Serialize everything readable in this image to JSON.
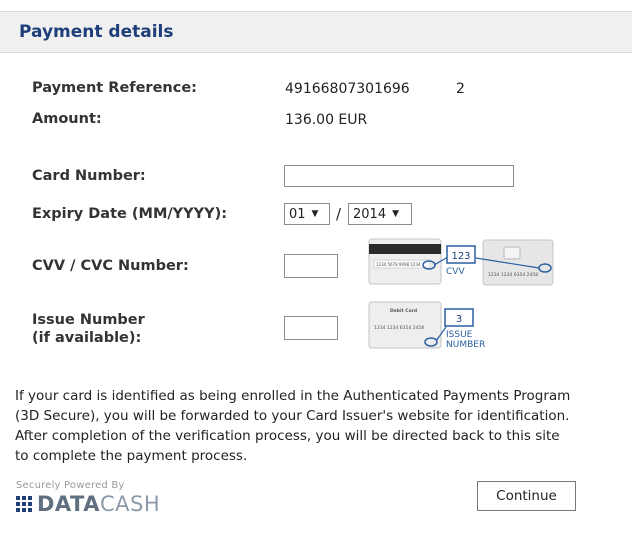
{
  "header": {
    "title": "Payment details"
  },
  "reference": {
    "label": "Payment Reference:",
    "value": "49166807301696",
    "suffix": "2"
  },
  "amount": {
    "label": "Amount:",
    "value": "136.00 EUR"
  },
  "card_number": {
    "label": "Card Number:",
    "value": ""
  },
  "expiry": {
    "label": "Expiry Date (MM/YYYY):",
    "month": "01",
    "separator": "/",
    "year": "2014"
  },
  "cvv": {
    "label": "CVV / CVC Number:",
    "value": "",
    "illustration": {
      "code": "123",
      "caption": "CVV",
      "card_number": "1234 1234 6354 2458",
      "back_digits": "1234 5678 9098 1234"
    }
  },
  "issue": {
    "label_line1": "Issue Number",
    "label_line2": "(if available):",
    "value": "",
    "illustration": {
      "code": "3",
      "caption_line1": "ISSUE",
      "caption_line2": "NUMBER",
      "card_title": "Debit Card",
      "card_number": "1234 1234 6354 2458"
    }
  },
  "info_text": "If your card is identified as being enrolled in the Authenticated Payments Program (3D Secure), you will be forwarded to your Card Issuer's website for identification. After completion of the verification process, you will be directed back to this site to complete the payment process.",
  "logo": {
    "tagline": "Securely Powered By",
    "brand_a": "DATA",
    "brand_b": "CASH"
  },
  "continue_button": {
    "label": "Continue"
  },
  "colors": {
    "header_text": "#1f3f7a",
    "highlight_blue": "#2a5fa0"
  }
}
